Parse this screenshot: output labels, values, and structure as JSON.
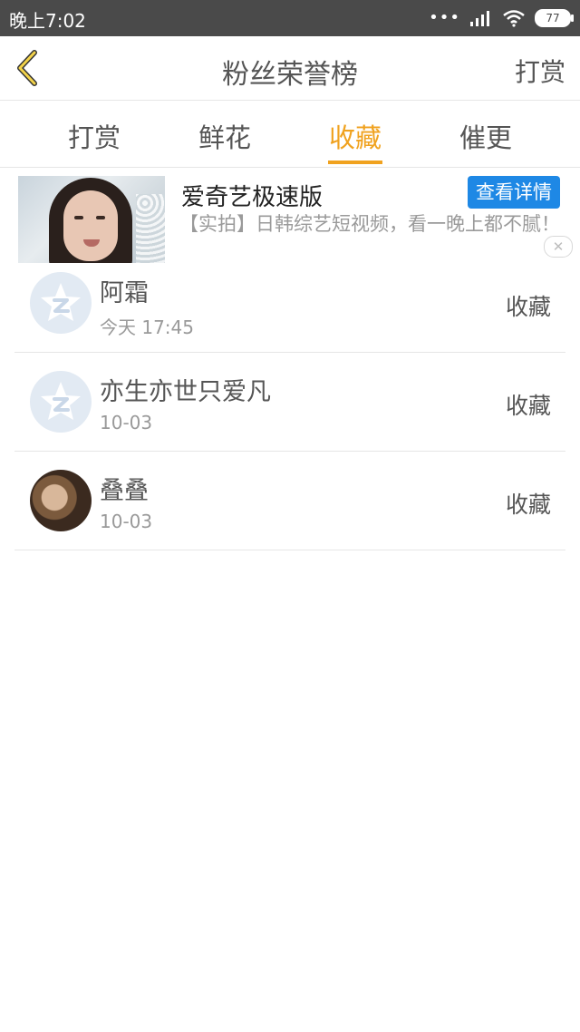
{
  "status_bar": {
    "time": "晚上7:02",
    "battery": "77"
  },
  "header": {
    "title": "粉丝荣誉榜",
    "action": "打赏"
  },
  "tabs": [
    {
      "label": "打赏"
    },
    {
      "label": "鲜花"
    },
    {
      "label": "收藏"
    },
    {
      "label": "催更"
    }
  ],
  "active_tab": "收藏",
  "ad": {
    "title": "爱奇艺极速版",
    "button": "查看详情",
    "description": "【实拍】日韩综艺短视频，看一晚上都不腻！"
  },
  "list": [
    {
      "name": "阿霜",
      "time": "今天 17:45",
      "action": "收藏",
      "avatar": "default"
    },
    {
      "name": "亦生亦世只爱凡",
      "time": "10-03",
      "action": "收藏",
      "avatar": "default"
    },
    {
      "name": "叠叠",
      "time": "10-03",
      "action": "收藏",
      "avatar": "photo"
    }
  ],
  "colors": {
    "accent": "#f0a21f",
    "status_bar": "#4a4a4a",
    "ad_button": "#1e88e5"
  }
}
